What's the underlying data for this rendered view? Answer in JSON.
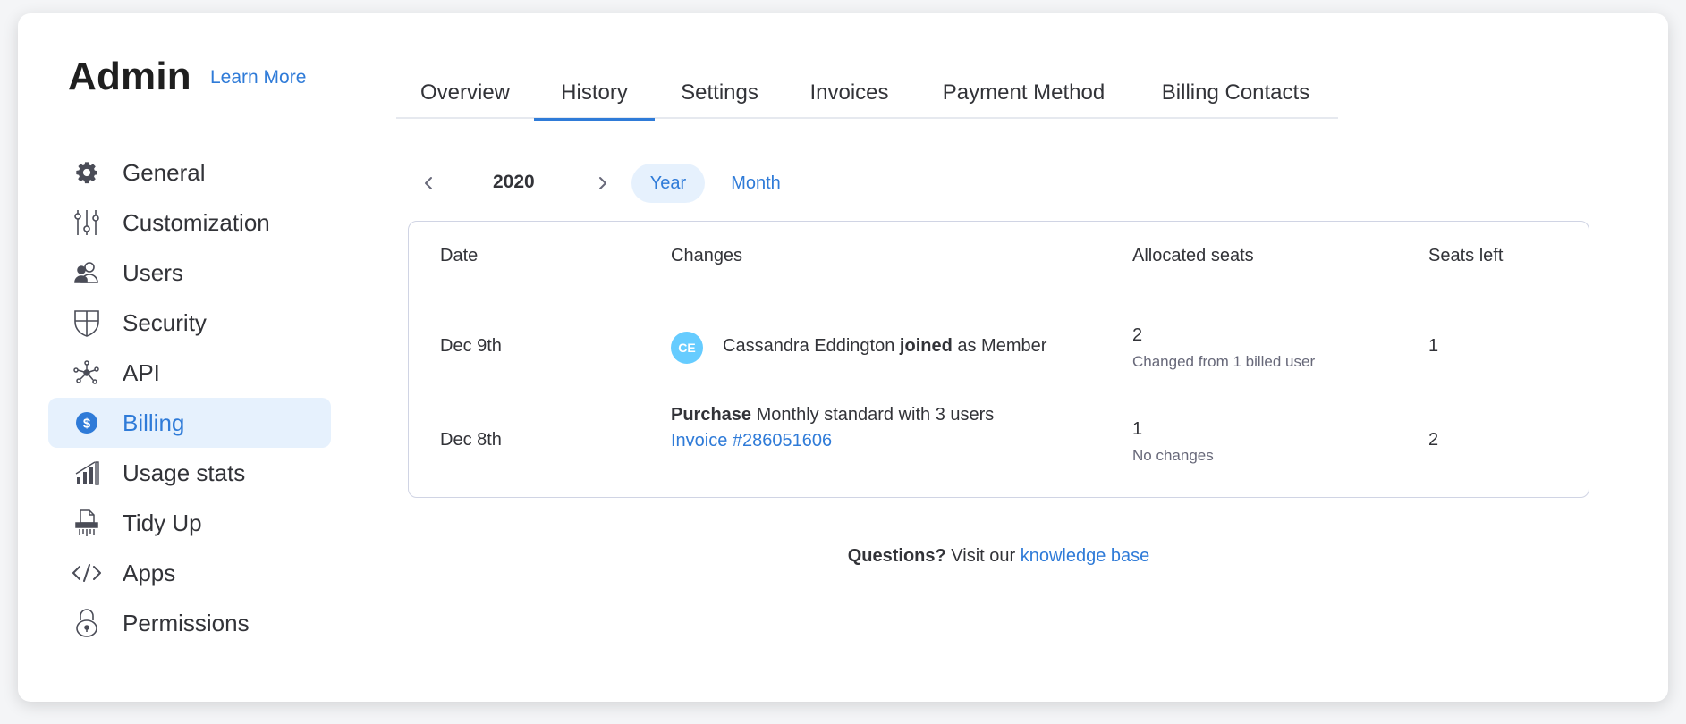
{
  "sidebar": {
    "title": "Admin",
    "learn_more": "Learn More",
    "items": [
      {
        "label": "General",
        "icon": "gear-icon"
      },
      {
        "label": "Customization",
        "icon": "sliders-icon"
      },
      {
        "label": "Users",
        "icon": "users-icon"
      },
      {
        "label": "Security",
        "icon": "shield-icon"
      },
      {
        "label": "API",
        "icon": "api-nodes-icon"
      },
      {
        "label": "Billing",
        "icon": "dollar-coin-icon",
        "active": true
      },
      {
        "label": "Usage stats",
        "icon": "bar-stats-icon"
      },
      {
        "label": "Tidy Up",
        "icon": "shredder-icon"
      },
      {
        "label": "Apps",
        "icon": "code-brackets-icon"
      },
      {
        "label": "Permissions",
        "icon": "lock-icon"
      }
    ]
  },
  "tabs": [
    {
      "label": "Overview"
    },
    {
      "label": "History",
      "active": true
    },
    {
      "label": "Settings"
    },
    {
      "label": "Invoices"
    },
    {
      "label": "Payment Method"
    },
    {
      "label": "Billing Contacts"
    }
  ],
  "period": {
    "year": "2020",
    "year_label": "Year",
    "month_label": "Month",
    "selected": "Year"
  },
  "table": {
    "headers": {
      "date": "Date",
      "changes": "Changes",
      "allocated": "Allocated seats",
      "left": "Seats left"
    },
    "rows": [
      {
        "date": "Dec 9th",
        "avatar_initials": "CE",
        "name": "Cassandra Eddington",
        "action": "joined",
        "suffix": "as Member",
        "allocated": "2",
        "allocated_note": "Changed from 1 billed user",
        "seats_left": "1"
      },
      {
        "date": "Dec 8th",
        "purchase_label": "Purchase",
        "purchase_text": "Monthly standard with 3 users",
        "invoice": "Invoice #286051606",
        "allocated": "1",
        "allocated_note": "No changes",
        "seats_left": "2"
      }
    ]
  },
  "footer": {
    "prefix": "Questions?",
    "middle": "Visit our",
    "link": "knowledge base"
  },
  "colors": {
    "accent": "#2f7bd8",
    "active_bg": "#e6f1fd",
    "avatar": "#66ccff",
    "border": "#d0d4e4"
  }
}
